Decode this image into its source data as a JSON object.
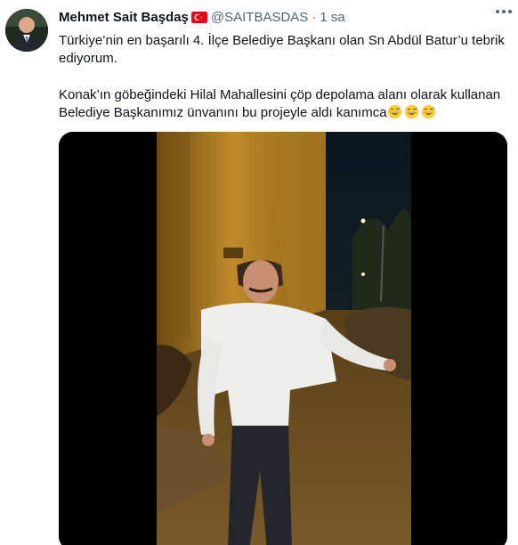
{
  "tweet": {
    "display_name": "Mehmet Sait Başdaş",
    "handle": "@SAITBASDAS",
    "separator": "·",
    "time": "1 sa",
    "text_line1": "Türkiye’nin en başarılı 4. İlçe Belediye Başkanı olan Sn Abdül Batur’u tebrik ediyorum.",
    "text_line2": "Konak’ın göbeğindeki Hilal Mahallesini çöp depolama alanı olarak kullanan Belediye Başkanımız ünvanını bu projeyle aldı kanımca",
    "emoji_count_label": "",
    "icons": {
      "flag": "turkey-flag-icon",
      "more": "more-options-icon",
      "emoji": "grinning-sweat-emoji-icon"
    }
  },
  "colors": {
    "text": "#0f1419",
    "secondary": "#536471",
    "flag_red": "#e30a17"
  }
}
